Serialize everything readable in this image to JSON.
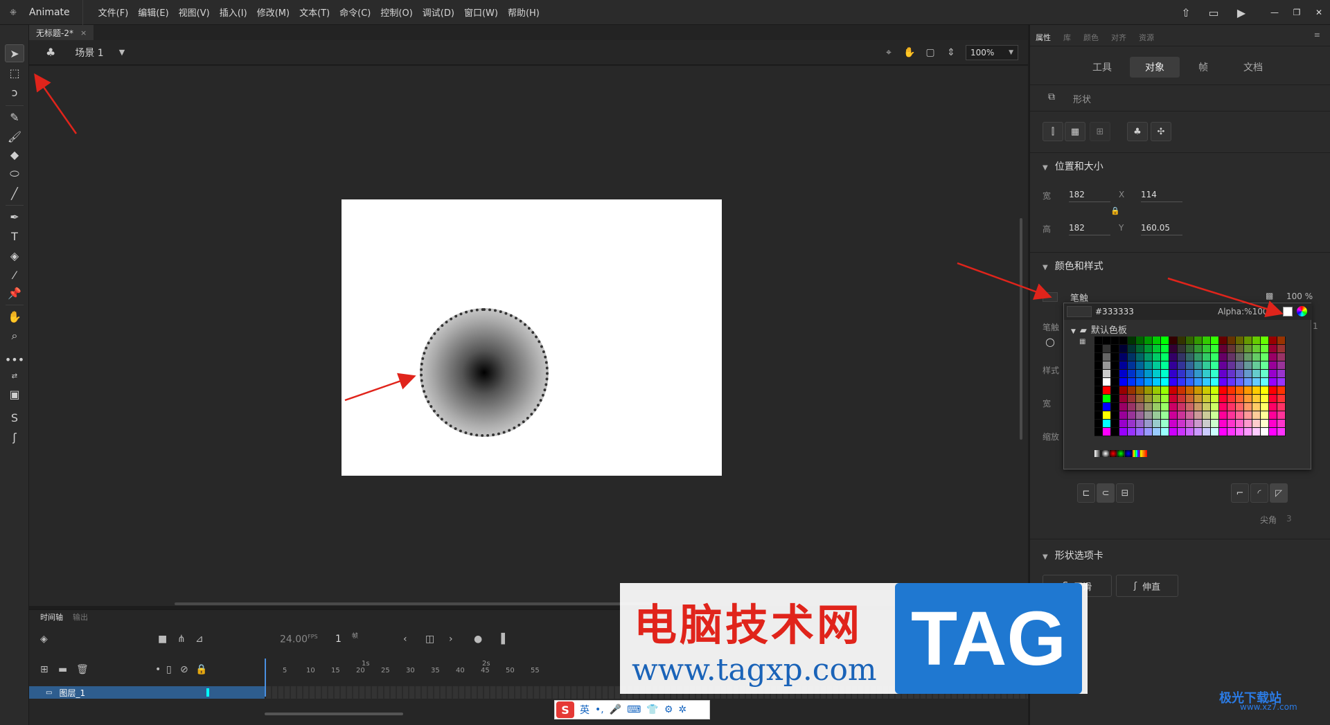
{
  "app": {
    "name": "Animate",
    "menu": [
      "文件(F)",
      "编辑(E)",
      "视图(V)",
      "插入(I)",
      "修改(M)",
      "文本(T)",
      "命令(C)",
      "控制(O)",
      "调试(D)",
      "窗口(W)",
      "帮助(H)"
    ]
  },
  "document": {
    "tab_title": "无标题-2*",
    "close": "×"
  },
  "scene": {
    "label": "场景 1",
    "zoom": "100%"
  },
  "timeline": {
    "tabs": [
      "时间轴",
      "输出"
    ],
    "fps": "24.00",
    "fps_unit": "FPS",
    "current_frame": "1",
    "frame_unit": "帧",
    "ruler_ticks": [
      "5",
      "10",
      "15",
      "20",
      "25",
      "30",
      "35",
      "40",
      "45",
      "50",
      "55"
    ],
    "ruler_marks": [
      "1s",
      "2s"
    ],
    "layer_name": "图层_1"
  },
  "properties": {
    "panel_tabs": [
      "属性",
      "库",
      "颜色",
      "对齐",
      "资源"
    ],
    "subtabs": [
      "工具",
      "对象",
      "帧",
      "文档"
    ],
    "active_subtab": "对象",
    "object_type": "形状",
    "sections": {
      "position_size": "位置和大小",
      "color_style": "颜色和样式",
      "shape_options": "形状选项卡"
    },
    "width_label": "宽",
    "height_label": "高",
    "width": "182",
    "height": "182",
    "x_label": "X",
    "y_label": "Y",
    "x": "114",
    "y": "160.05",
    "stroke_label": "笔触",
    "stroke_alpha": "100 %",
    "side_labels": [
      "笔触",
      "样式",
      "宽",
      "缩放"
    ],
    "corner_label": "尖角",
    "corner_value": "3",
    "smooth_button": "平滑",
    "straighten_button": "伸直",
    "cut_digit": "1"
  },
  "swatch_popup": {
    "hex": "#333333",
    "alpha_label": "Alpha:%",
    "alpha_value": "100",
    "palette_title": "默认色板"
  },
  "watermark": {
    "site_cn": "电脑技术网",
    "site_url": "www.tagxp.com",
    "tag": "TAG",
    "site2": "极光下载站",
    "site2_url": "www.xz7.com"
  },
  "ime": {
    "mode": "英"
  },
  "colors": {
    "accent": "#4a90e2",
    "layer_row": "#2e5d8e",
    "layer_color": "#00ffff",
    "arrow": "#e0241b"
  }
}
